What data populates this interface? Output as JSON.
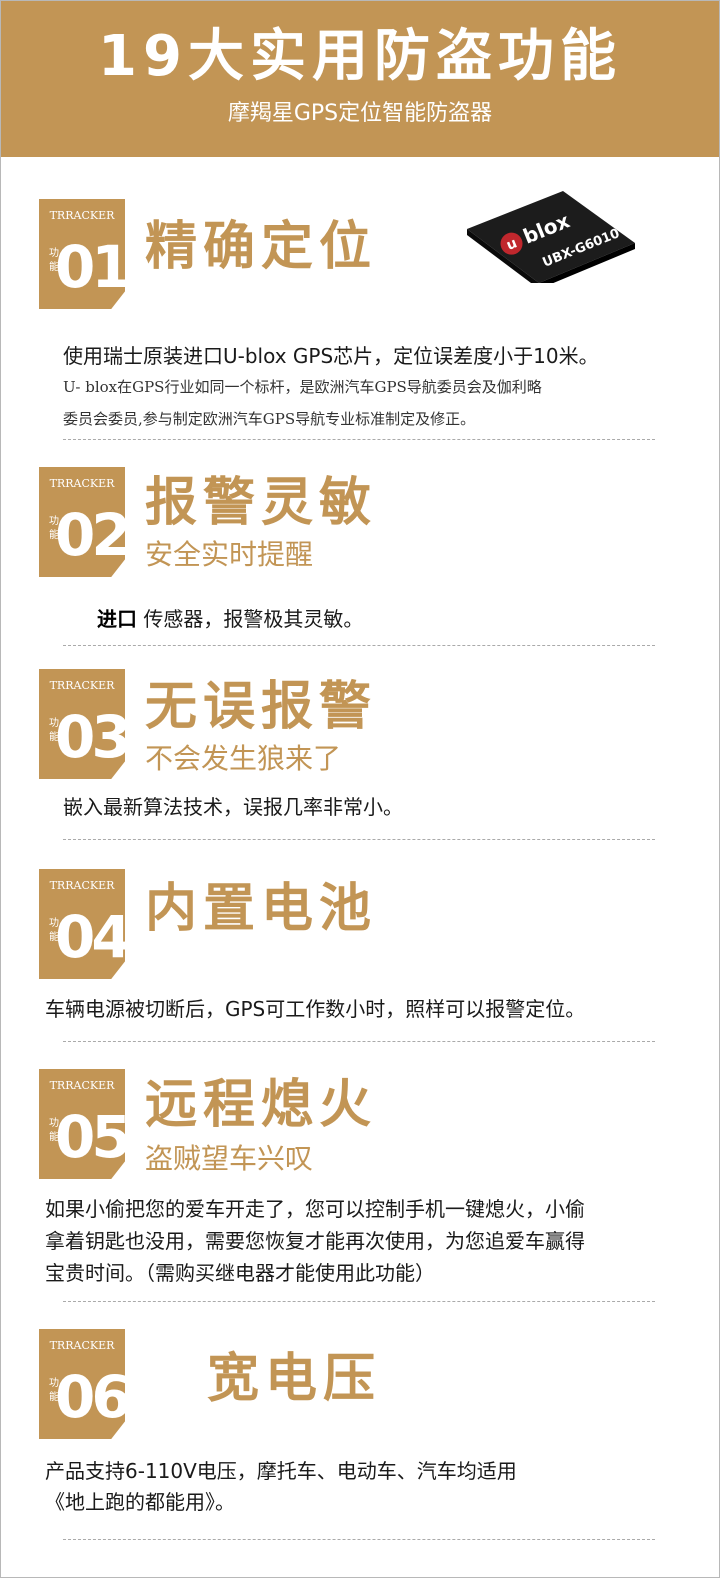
{
  "header": {
    "title": "19大实用防盗功能",
    "subtitle": "摩羯星GPS定位智能防盗器"
  },
  "badge": {
    "brand": "TRRACKER",
    "label": "功能"
  },
  "chip": {
    "brand": "blox",
    "brand_mark": "u",
    "model": "UBX-G6010"
  },
  "features": [
    {
      "num": "01",
      "title": "精确定位",
      "lines": [
        "使用瑞士原装进口U-blox GPS芯片，定位误差度小于10米。"
      ],
      "detail": [
        "U- blox在GPS行业如同一个标杆，是欧洲汽车GPS导航委员会及伽利略",
        "委员会委员,参与制定欧洲汽车GPS导航专业标准制定及修正。"
      ]
    },
    {
      "num": "02",
      "title": "报警灵敏",
      "subtitle": "安全实时提醒",
      "lead": "进口",
      "text": "传感器，报警极其灵敏。"
    },
    {
      "num": "03",
      "title": "无误报警",
      "subtitle": "不会发生狼来了",
      "lines": [
        "嵌入最新算法技术，误报几率非常小。"
      ]
    },
    {
      "num": "04",
      "title": "内置电池",
      "lines": [
        "车辆电源被切断后，GPS可工作数小时，照样可以报警定位。"
      ]
    },
    {
      "num": "05",
      "title": "远程熄火",
      "subtitle": "盗贼望车兴叹",
      "lines": [
        "如果小偷把您的爱车开走了，您可以控制手机一键熄火，小偷",
        "拿着钥匙也没用，需要您恢复才能再次使用，为您追爱车赢得",
        "宝贵时间。（需购买继电器才能使用此功能）"
      ]
    },
    {
      "num": "06",
      "title": "宽电压",
      "lines": [
        "产品支持6-110V电压，摩托车、电动车、汽车均适用",
        "《地上跑的都能用》。"
      ]
    }
  ]
}
